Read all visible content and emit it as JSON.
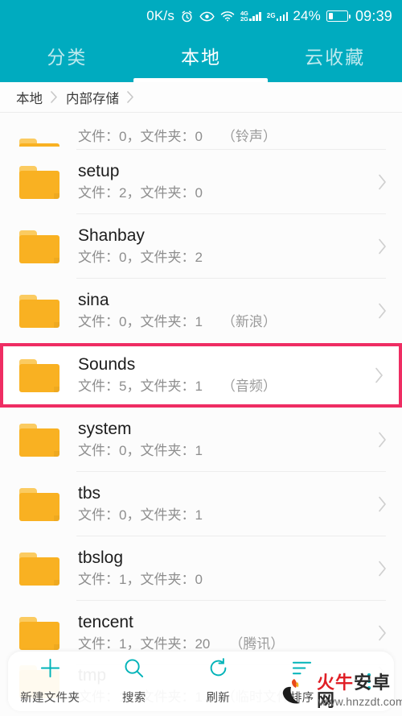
{
  "statusbar": {
    "network_speed": "0K/s",
    "battery_percent": "24%",
    "clock": "09:39",
    "signal1_label_top": "4G",
    "signal1_label_bottom": "2G",
    "signal2_label": "2G",
    "icons": [
      "alarm-icon",
      "eye-icon",
      "wifi-icon",
      "signal-4g-icon",
      "signal-2g-icon",
      "battery-icon"
    ]
  },
  "tabs": [
    {
      "label": "分类",
      "active": false
    },
    {
      "label": "本地",
      "active": true
    },
    {
      "label": "云收藏",
      "active": false
    }
  ],
  "breadcrumb": {
    "items": [
      "本地",
      "内部存储"
    ],
    "separator": "›"
  },
  "list": {
    "rows": [
      {
        "name": "",
        "sub": "文件：0，文件夹：0",
        "note": "（铃声）",
        "partial_top": true,
        "highlight": false
      },
      {
        "name": "setup",
        "sub": "文件：2，文件夹：0",
        "note": "",
        "highlight": false
      },
      {
        "name": "Shanbay",
        "sub": "文件：0，文件夹：2",
        "note": "",
        "highlight": false
      },
      {
        "name": "sina",
        "sub": "文件：0，文件夹：1",
        "note": "（新浪）",
        "highlight": false
      },
      {
        "name": "Sounds",
        "sub": "文件：5，文件夹：1",
        "note": "（音频）",
        "highlight": true
      },
      {
        "name": "system",
        "sub": "文件：0，文件夹：1",
        "note": "",
        "highlight": false
      },
      {
        "name": "tbs",
        "sub": "文件：0，文件夹：1",
        "note": "",
        "highlight": false
      },
      {
        "name": "tbslog",
        "sub": "文件：1，文件夹：0",
        "note": "",
        "highlight": false
      },
      {
        "name": "tencent",
        "sub": "文件：1，文件夹：20",
        "note": "（腾讯）",
        "highlight": false
      },
      {
        "name": "tmp",
        "sub": "文件：1，文件夹：1",
        "note": "（临时文件）",
        "partial_bottom": true,
        "highlight": false
      }
    ]
  },
  "bottombar": {
    "items": [
      {
        "label": "新建文件夹",
        "icon": "plus-icon"
      },
      {
        "label": "搜索",
        "icon": "search-icon"
      },
      {
        "label": "刷新",
        "icon": "refresh-icon"
      },
      {
        "label": "排序",
        "icon": "sort-icon"
      }
    ],
    "more_icon": "more-vertical-icon"
  },
  "watermark": {
    "brand_red": "火牛",
    "brand_dark": "安卓网",
    "url": "www.hnzzdt.com"
  },
  "colors": {
    "accent_teal": "#00abbf",
    "folder_amber": "#f9b122",
    "highlight_pink": "#ef2d63",
    "toolbar_icon": "#00b3b8"
  }
}
